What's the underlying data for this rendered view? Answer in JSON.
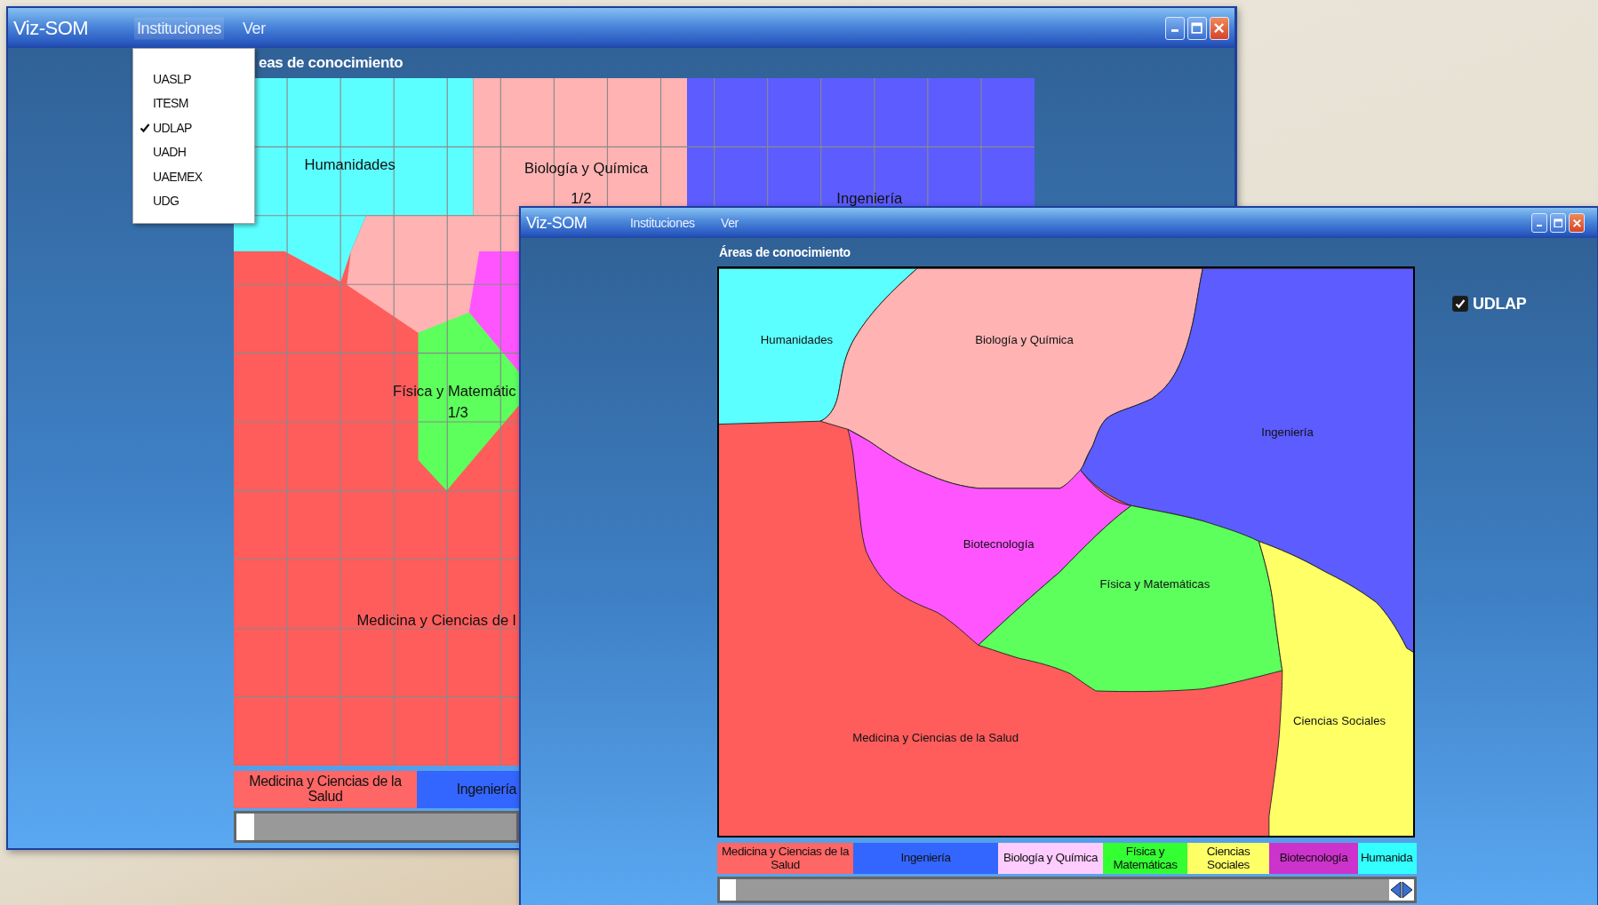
{
  "back_window": {
    "title": "Viz-SOM",
    "menu": [
      {
        "label": "Instituciones",
        "selected": true
      },
      {
        "label": "Ver",
        "selected": false
      }
    ],
    "dropdown": [
      {
        "label": "UASLP",
        "checked": false
      },
      {
        "label": "ITESM",
        "checked": false
      },
      {
        "label": "UDLAP",
        "checked": true
      },
      {
        "label": "UADH",
        "checked": false
      },
      {
        "label": "UAEMEX",
        "checked": false
      },
      {
        "label": "UDG",
        "checked": false
      }
    ],
    "heading": "eas de conocimiento",
    "map_regions": [
      {
        "label": "Medicina y Ciencias de l",
        "color": "#ff5c5c"
      },
      {
        "label": "Humanidades",
        "color": "#5cffff"
      },
      {
        "label": "Biología y Química",
        "sublabel": "1/2",
        "color": "#ffb3b3"
      },
      {
        "label": "Ingeniería",
        "color": "#5c5cff"
      },
      {
        "color": "#ff55ff"
      },
      {
        "label": "Física y Matemátic",
        "sublabel": "1/3",
        "color": "#5cff5c"
      }
    ],
    "legend": [
      {
        "label": "Medicina y Ciencias de la Salud",
        "color": "#ff6666"
      },
      {
        "label": "Ingeniería",
        "color": "#3366ff"
      }
    ]
  },
  "front_window": {
    "title": "Viz-SOM",
    "menu": [
      {
        "label": "Instituciones",
        "selected": false
      },
      {
        "label": "Ver",
        "selected": false
      }
    ],
    "heading": "Áreas de conocimiento",
    "map_regions": [
      {
        "label": "Medicina y Ciencias de la Salud",
        "color": "#ff5c5c"
      },
      {
        "label": "Humanidades",
        "color": "#5cffff"
      },
      {
        "label": "Biología y Química",
        "color": "#ffb3b3"
      },
      {
        "label": "Ingeniería",
        "color": "#5c5cff"
      },
      {
        "label": "Biotecnología",
        "color": "#ff55ff"
      },
      {
        "label": "Física y Matemáticas",
        "color": "#5cff5c"
      },
      {
        "label": "Ciencias Sociales",
        "color": "#ffff66"
      }
    ],
    "institution": {
      "label": "UDLAP",
      "checked": true
    },
    "legend": [
      {
        "label": "Medicina y Ciencias de la Salud",
        "color": "#ff6666"
      },
      {
        "label": "Ingeniería",
        "color": "#3366ff"
      },
      {
        "label": "Biología y Química",
        "color": "#ffccff"
      },
      {
        "label": "Física y Matemáticas",
        "color": "#33ff33"
      },
      {
        "label": "Ciencias Sociales",
        "color": "#ffff66"
      },
      {
        "label": "Biotecnología",
        "color": "#cc33cc"
      },
      {
        "label": "Humanida",
        "color": "#33ffff"
      }
    ]
  }
}
